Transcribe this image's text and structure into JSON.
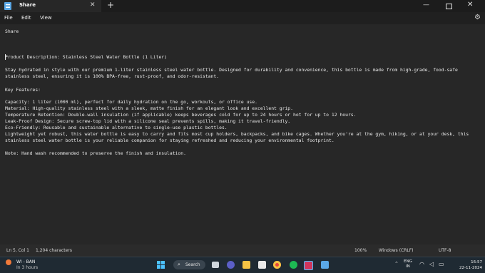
{
  "window": {
    "tab_title": "Share",
    "tab_close_icon": "close-icon",
    "new_tab_symbol": "+",
    "minimize_symbol": "—",
    "close_symbol": "✕"
  },
  "menu": {
    "items": [
      "File",
      "Edit",
      "View"
    ],
    "settings_icon": "gear-icon"
  },
  "document": {
    "lines": [
      "Share",
      "",
      "",
      "",
      "Product Description: Stainless Steel Water Bottle (1 Liter)",
      "",
      "Stay hydrated in style with our premium 1-liter stainless steel water bottle. Designed for durability and convenience, this bottle is made from high-grade, food-safe",
      "stainless steel, ensuring it is 100% BPA-free, rust-proof, and odor-resistant.",
      "",
      "Key Features:",
      "",
      "Capacity: 1 liter (1000 ml), perfect for daily hydration on the go, workouts, or office use.",
      "Material: High-quality stainless steel with a sleek, matte finish for an elegant look and excellent grip.",
      "Temperature Retention: Double-wall insulation (if applicable) keeps beverages cold for up to 24 hours or hot for up to 12 hours.",
      "Leak-Proof Design: Secure screw-top lid with a silicone seal prevents spills, making it travel-friendly.",
      "Eco-Friendly: Reusable and sustainable alternative to single-use plastic bottles.",
      "Lightweight yet robust, this water bottle is easy to carry and fits most cup holders, backpacks, and bike cages. Whether you're at the gym, hiking, or at your desk, this",
      "stainless steel water bottle is your reliable companion for staying refreshed and reducing your environmental footprint.",
      "",
      "Note: Hand wash recommended to preserve the finish and insulation."
    ]
  },
  "status": {
    "position": "Ln 5, Col 1",
    "characters": "1,204 characters",
    "zoom": "100%",
    "line_ending": "Windows (CRLF)",
    "encoding": "UTF-8"
  },
  "taskbar": {
    "weather": {
      "temp": "WI - BAN",
      "note": "In 3 hours"
    },
    "search_label": "Search",
    "language": "ENG",
    "region": "IN",
    "time": "16:57",
    "date": "22-11-2024",
    "colors": {
      "explorer": "#f6c344",
      "chrome": "#e8453c",
      "spotify": "#1db954",
      "teams": "#5b5fc7",
      "notepad": "#5aa7e6",
      "accent": "#4cc2ff"
    }
  }
}
